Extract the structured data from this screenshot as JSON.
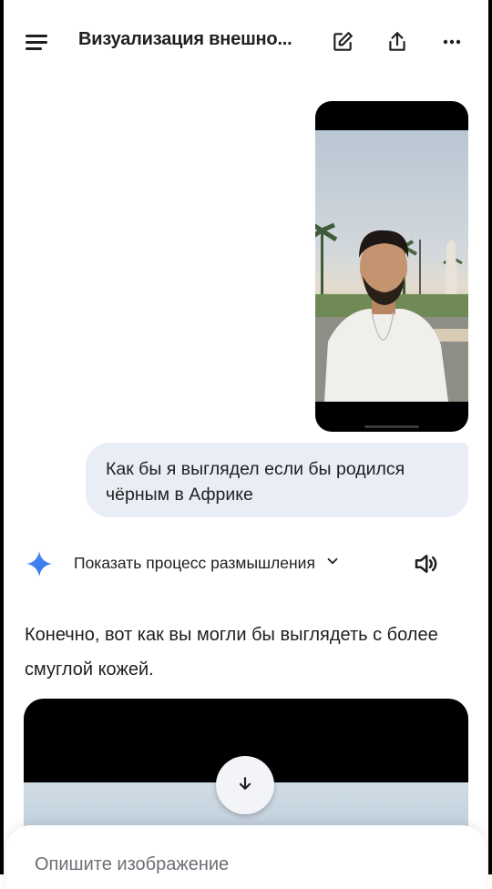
{
  "header": {
    "title": "Визуализация внешно...",
    "icons": [
      "menu-icon",
      "edit-icon",
      "share-icon",
      "more-icon"
    ]
  },
  "conversation": {
    "user_message": "Как бы я выглядел если бы родился чёрным в Африке",
    "thinking_label": "Показать процесс размышления",
    "response_text": "Конечно, вот как вы могли бы выглядеть с более смуглой кожей."
  },
  "input": {
    "placeholder": "Опишите изображение"
  },
  "colors": {
    "user_bubble": "#e9eef6",
    "accent_blue": "#4285f4",
    "text": "#1f1f1f"
  }
}
